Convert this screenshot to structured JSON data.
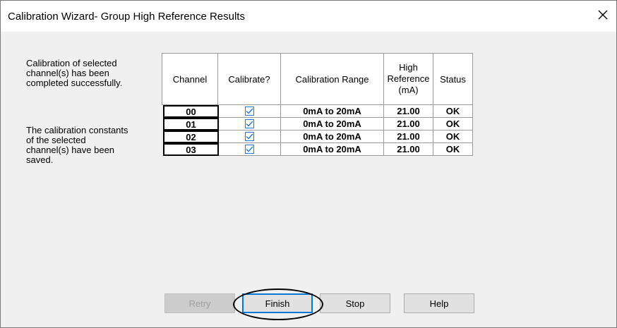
{
  "window": {
    "title": "Calibration Wizard- Group High Reference Results",
    "close_icon": "close-icon"
  },
  "messages": {
    "success": "Calibration of selected\nchannel(s) has been\ncompleted successfully.",
    "saved": "The calibration constants\nof the selected\nchannel(s) have been\nsaved."
  },
  "table": {
    "headers": {
      "channel": "Channel",
      "calibrate": "Calibrate?",
      "range": "Calibration Range",
      "high_ref": "High\nReference\n(mA)",
      "status": "Status"
    },
    "rows": [
      {
        "channel": "00",
        "calibrate": true,
        "range": "0mA to 20mA",
        "high_ref": "21.00",
        "status": "OK"
      },
      {
        "channel": "01",
        "calibrate": true,
        "range": "0mA to 20mA",
        "high_ref": "21.00",
        "status": "OK"
      },
      {
        "channel": "02",
        "calibrate": true,
        "range": "0mA to 20mA",
        "high_ref": "21.00",
        "status": "OK"
      },
      {
        "channel": "03",
        "calibrate": true,
        "range": "0mA to 20mA",
        "high_ref": "21.00",
        "status": "OK"
      }
    ]
  },
  "buttons": {
    "retry": "Retry",
    "finish": "Finish",
    "stop": "Stop",
    "help": "Help"
  },
  "colors": {
    "checkbox": "#1c7cd5",
    "default_button_border": "#0078d7"
  }
}
